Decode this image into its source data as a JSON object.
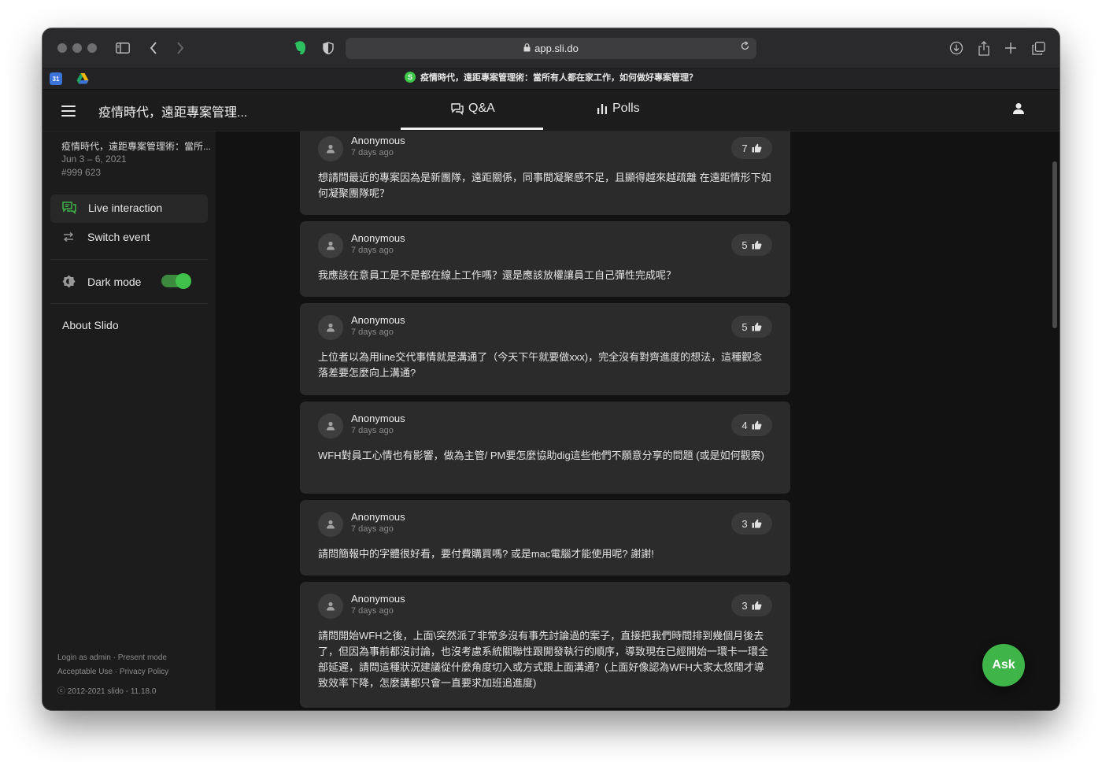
{
  "browser": {
    "url": "app.sli.do",
    "active_tab_title": "疫情時代，遠距專案管理術：當所有人都在家工作，如何做好專案管理？",
    "active_tab_favicon": "S",
    "calendar_favicon": "31"
  },
  "header": {
    "event_title": "疫情時代，遠距專案管理...",
    "tabs": [
      {
        "label": "Q&A",
        "icon": "chat-icon",
        "active": true
      },
      {
        "label": "Polls",
        "icon": "bar-chart-icon",
        "active": false
      }
    ]
  },
  "sidebar": {
    "event_name": "疫情時代，遠距專案管理術：當所...",
    "event_dates": "Jun 3 – 6, 2021",
    "event_code": "#999 623",
    "live_interaction": "Live interaction",
    "switch_event": "Switch event",
    "dark_mode": "Dark mode",
    "dark_mode_on": true,
    "about": "About Slido",
    "footer": {
      "login": "Login as admin · Present mode",
      "policy": "Acceptable Use · Privacy Policy",
      "copyright": "ⓒ 2012-2021 slido - 11.18.0"
    }
  },
  "questions": [
    {
      "author": "Anonymous",
      "ago": "7 days ago",
      "likes": "7",
      "text": "想請問最近的專案因為是新團隊，遠距關係，同事間凝聚感不足，且顯得越來越疏離 在遠距情形下如何凝聚團隊呢？"
    },
    {
      "author": "Anonymous",
      "ago": "7 days ago",
      "likes": "5",
      "text": "我應該在意員工是不是都在線上工作嗎？還是應該放權讓員工自己彈性完成呢？"
    },
    {
      "author": "Anonymous",
      "ago": "7 days ago",
      "likes": "5",
      "text": "上位者以為用line交代事情就是溝通了（今天下午就要做xxx)，完全沒有對齊進度的想法，這種觀念落差要怎麼向上溝通?"
    },
    {
      "author": "Anonymous",
      "ago": "7 days ago",
      "likes": "4",
      "text": "WFH對員工心情也有影響，做為主管/ PM要怎麼協助dig這些他們不願意分享的問題 (或是如何觀察)"
    },
    {
      "author": "Anonymous",
      "ago": "7 days ago",
      "likes": "3",
      "text": "請問簡報中的字體很好看，要付費購買嗎? 或是mac電腦才能使用呢? 謝謝!"
    },
    {
      "author": "Anonymous",
      "ago": "7 days ago",
      "likes": "3",
      "text": "請問開始WFH之後，上面\\突然派了非常多沒有事先討論過的案子，直接把我們時間排到幾個月後去了，但因為事前都沒討論，也沒考慮系統關聯性跟開發執行的順序，導致現在已經開始一環卡一環全部延遲，請問這種狀況建議從什麼角度切入或方式跟上面溝通？(上面好像認為WFH大家太悠閒才導致效率下降，怎麼講都只會一直要求加班追進度)"
    }
  ],
  "ask_button": "Ask",
  "colors": {
    "accent": "#3fb549",
    "background": "#121212",
    "card": "#2b2b2b"
  }
}
